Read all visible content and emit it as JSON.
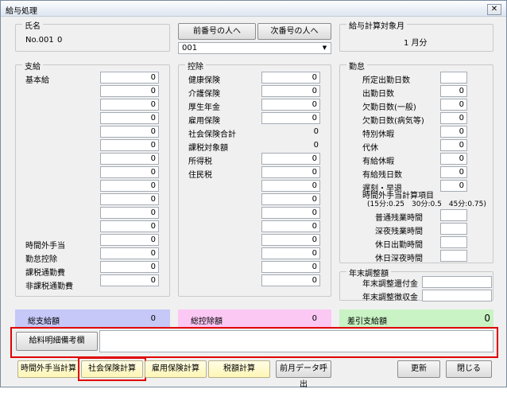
{
  "title": "給与処理",
  "close_glyph": "✕",
  "name_group": {
    "legend": "氏名",
    "employee_no": "No.001",
    "employee_name": "0"
  },
  "nav": {
    "prev_label": "前番号の人へ",
    "next_label": "次番号の人へ",
    "select_value": "001"
  },
  "month_group": {
    "legend": "給与計算対象月",
    "value": "1 月分"
  },
  "payment": {
    "legend": "支給",
    "base_label": "基本給",
    "values": [
      "0",
      "0",
      "0",
      "0",
      "0",
      "0",
      "0",
      "0",
      "0",
      "0",
      "0",
      "0",
      "0",
      "0",
      "0",
      "0"
    ],
    "bottom_labels": [
      "時間外手当",
      "勤怠控除",
      "課税通勤費",
      "非課税通勤費"
    ]
  },
  "deduction": {
    "legend": "控除",
    "items": [
      {
        "label": "健康保険",
        "value": "0",
        "box": true
      },
      {
        "label": "介護保険",
        "value": "0",
        "box": true
      },
      {
        "label": "厚生年金",
        "value": "0",
        "box": true
      },
      {
        "label": "雇用保険",
        "value": "0",
        "box": true
      },
      {
        "label": "社会保険合計",
        "value": "0",
        "box": false
      },
      {
        "label": "課税対象額",
        "value": "0",
        "box": false
      },
      {
        "label": "所得税",
        "value": "0",
        "box": true
      },
      {
        "label": "住民税",
        "value": "0",
        "box": true
      },
      {
        "label": "",
        "value": "0",
        "box": true
      },
      {
        "label": "",
        "value": "0",
        "box": true
      },
      {
        "label": "",
        "value": "0",
        "box": true
      },
      {
        "label": "",
        "value": "0",
        "box": true
      },
      {
        "label": "",
        "value": "0",
        "box": true
      },
      {
        "label": "",
        "value": "0",
        "box": true
      },
      {
        "label": "",
        "value": "0",
        "box": true
      },
      {
        "label": "",
        "value": "0",
        "box": true
      }
    ]
  },
  "attendance": {
    "legend": "勤怠",
    "items": [
      {
        "label": "所定出勤日数",
        "value": ""
      },
      {
        "label": "出勤日数",
        "value": "0"
      },
      {
        "label": "欠勤日数(一般)",
        "value": "0"
      },
      {
        "label": "欠勤日数(病気等)",
        "value": "0"
      },
      {
        "label": "特別休暇",
        "value": "0"
      },
      {
        "label": "代休",
        "value": "0"
      },
      {
        "label": "有給休暇",
        "value": "0"
      },
      {
        "label": "有給残日数",
        "value": "0"
      },
      {
        "label": "遅刻・早退",
        "value": "0"
      }
    ],
    "overtime_title": "時間外手当計算項目",
    "overtime_note": "(15分:0.25　30分:0.5　45分:0.75)",
    "overtime_items": [
      "普通残業時間",
      "深夜残業時間",
      "休日出勤時間",
      "休日深夜時間"
    ]
  },
  "year_end": {
    "legend": "年末調整額",
    "refund_label": "年末調整還付金",
    "collect_label": "年末調整徴収金"
  },
  "totals": {
    "pay_label": "総支給額",
    "pay_value": "0",
    "pay_color": "#c6c8f8",
    "ded_label": "総控除額",
    "ded_value": "0",
    "ded_color": "#fbc8f4",
    "net_label": "差引支給額",
    "net_value": "0",
    "net_color": "#c9f3c4"
  },
  "remarks": {
    "label": "給料明細備考欄",
    "value": ""
  },
  "buttons": {
    "overtime_calc": "時間外手当計算",
    "social_calc": "社会保険計算",
    "employment_calc": "雇用保険計算",
    "tax_calc": "税額計算",
    "prev_month": "前月データ呼出",
    "update": "更新",
    "close": "閉じる"
  }
}
